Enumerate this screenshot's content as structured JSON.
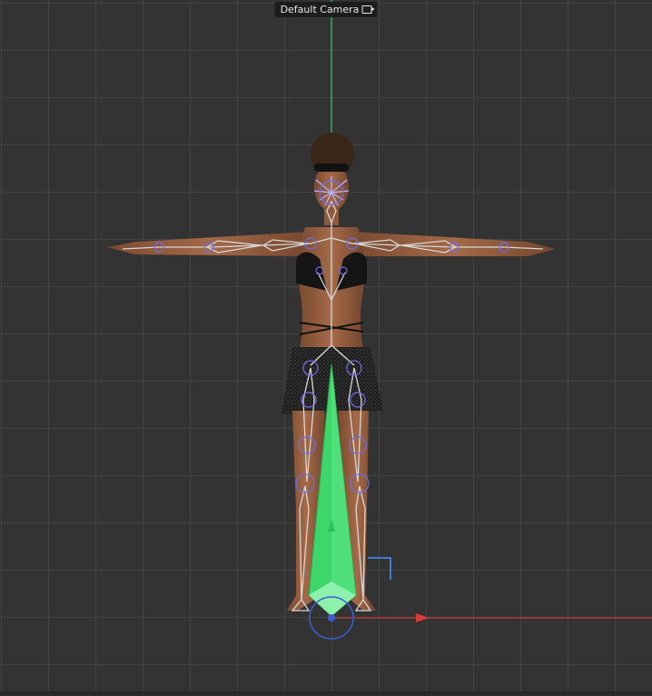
{
  "viewport": {
    "camera_label": "Default Camera",
    "camera_icon": "camera-icon",
    "colors": {
      "background": "#333333",
      "grid": "#444444",
      "y_axis": "#3fdc6a",
      "x_axis": "#e23a3a",
      "bone_gizmo": "#3ed66a",
      "rotation_ring": "#3d5fd6",
      "skeleton": "#d8d8d8",
      "joint": "#6e6ee8",
      "skin": "#9a6646"
    }
  }
}
